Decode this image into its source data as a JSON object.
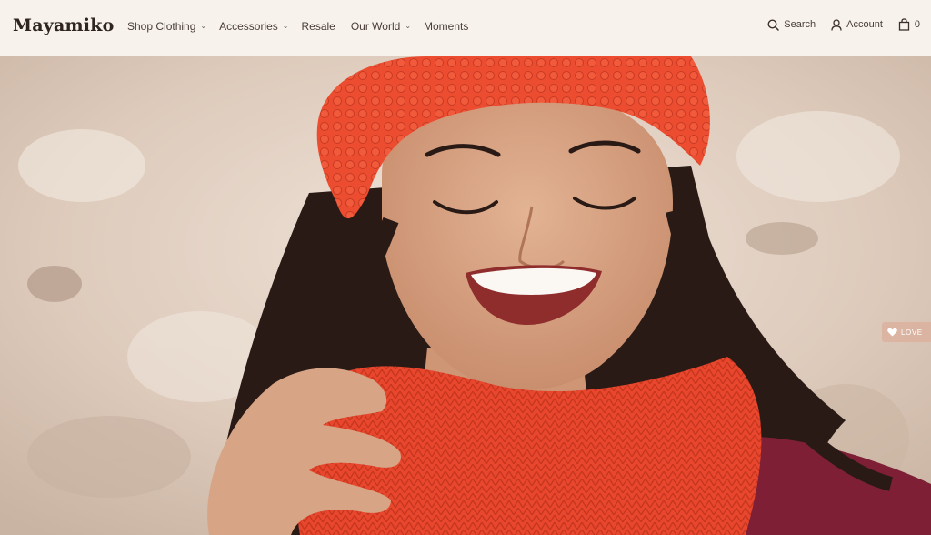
{
  "brand": {
    "name": "Mayamiko"
  },
  "nav": {
    "items": [
      {
        "label": "Shop Clothing",
        "has_dropdown": true
      },
      {
        "label": "Accessories",
        "has_dropdown": true
      },
      {
        "label": "Resale",
        "has_dropdown": false
      },
      {
        "label": "Our World",
        "has_dropdown": true
      },
      {
        "label": "Moments",
        "has_dropdown": false
      }
    ]
  },
  "utility": {
    "search_label": "Search",
    "account_label": "Account",
    "cart_count": "0"
  },
  "love_tab": {
    "label": "LOVE",
    "icon": "heart-icon"
  },
  "colors": {
    "header_bg": "#f7f2ec",
    "accent_red": "#e8462c",
    "text": "#3a2f2a"
  }
}
